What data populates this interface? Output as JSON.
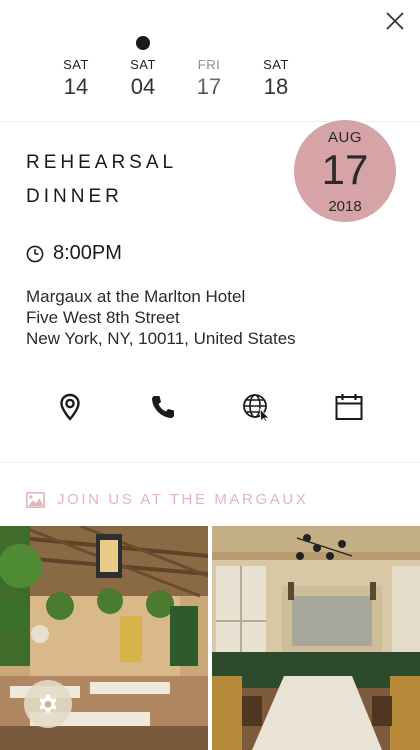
{
  "dates": [
    {
      "dow": "SAT",
      "num": "14"
    },
    {
      "dow": "SAT",
      "num": "04"
    },
    {
      "dow": "FRI",
      "num": "17"
    },
    {
      "dow": "SAT",
      "num": "18"
    }
  ],
  "event": {
    "title_line1": "REHEARSAL",
    "title_line2": "DINNER",
    "month": "AUG",
    "day": "17",
    "year": "2018",
    "time": "8:00PM",
    "address_line1": "Margaux at the Marlton Hotel",
    "address_line2": "Five West 8th Street",
    "address_line3": "New York, NY, 10011, United States"
  },
  "actions": [
    "location-pin-icon",
    "phone-icon",
    "globe-icon",
    "calendar-icon"
  ],
  "gallery": {
    "heading": "JOIN US AT THE MARGAUX"
  },
  "colors": {
    "accent_circle": "#d6a3a7",
    "heading_pink": "#e2b6ba",
    "text_dark": "#1a1a1a"
  }
}
